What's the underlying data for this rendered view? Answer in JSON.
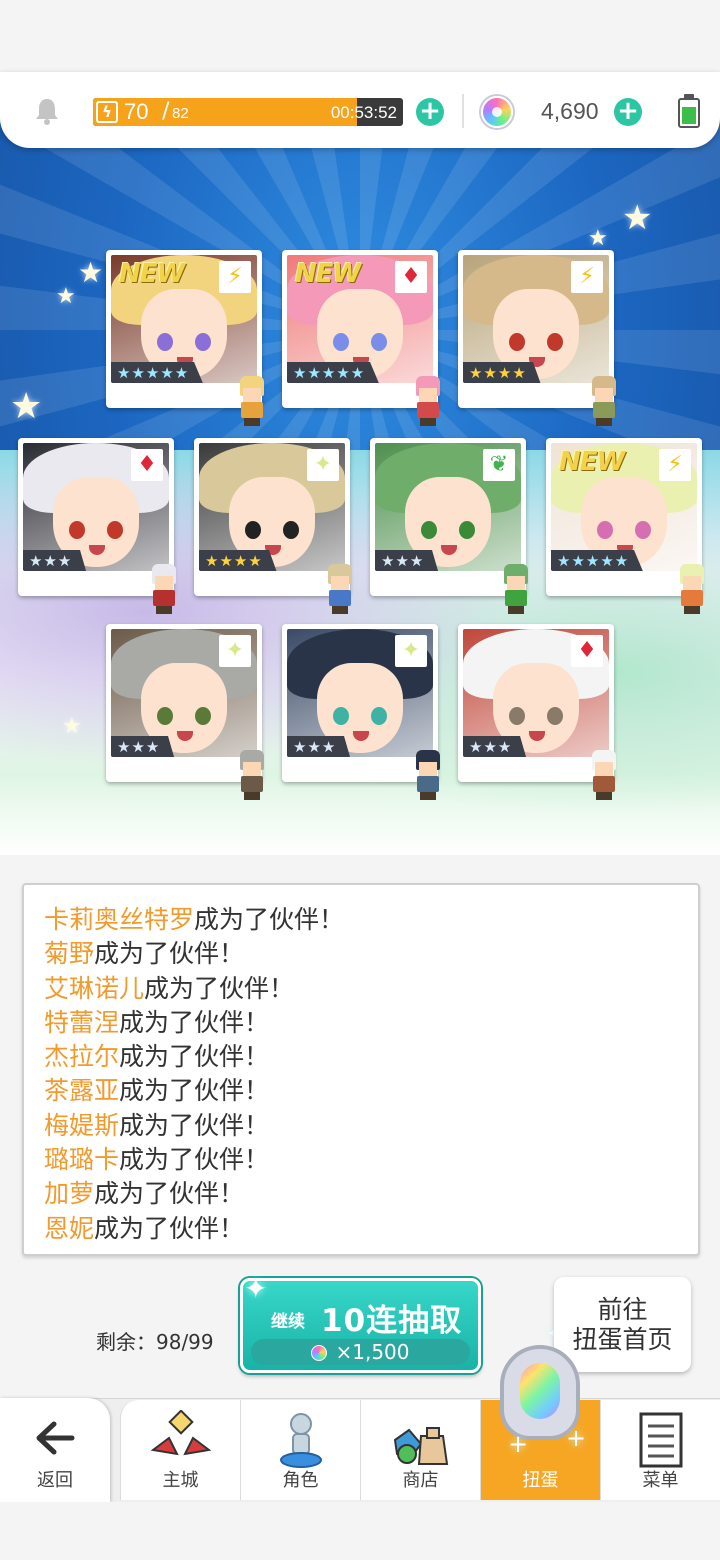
{
  "status": {
    "stamina_current": "70",
    "stamina_max": "82",
    "stamina_fraction": 0.85,
    "stamina_timer": "00:53:52",
    "gems": "4,690",
    "battery_icon": "battery-icon",
    "bell_icon": "bell-icon"
  },
  "colors": {
    "accent_orange": "#f7a21b",
    "accent_teal": "#2cc6a5",
    "name_orange": "#f39a2d",
    "nav_active": "#f6a623"
  },
  "cards": [
    {
      "new": "NEW",
      "element": "⚡",
      "element_color": "#f3c21a",
      "rarity": "★★★★★",
      "rarity_style": "rain",
      "hair": "#f3d47e",
      "eye": "#8b6fd6",
      "bg": "#7a3a2a",
      "sprite": "#e6a23c"
    },
    {
      "new": "NEW",
      "element": "♦",
      "element_color": "#e2263a",
      "rarity": "★★★★★",
      "rarity_style": "rain",
      "hair": "#f49ab8",
      "eye": "#7a8de8",
      "bg": "#f07a7a",
      "sprite": "#d24a4a"
    },
    {
      "new": "",
      "element": "⚡",
      "element_color": "#f3c21a",
      "rarity": "★★★★",
      "rarity_style": "gold",
      "hair": "#d6b98a",
      "eye": "#c0392b",
      "bg": "#b8a47a",
      "sprite": "#8a9a58"
    },
    {
      "new": "",
      "element": "♦",
      "element_color": "#e2263a",
      "rarity": "★★★",
      "rarity_style": "silver",
      "hair": "#e9e9ef",
      "eye": "#c0392b",
      "bg": "#2b2b33",
      "sprite": "#b73030"
    },
    {
      "new": "",
      "element": "✦",
      "element_color": "#d9e88a",
      "rarity": "★★★★",
      "rarity_style": "gold",
      "hair": "#d8c89a",
      "eye": "#222222",
      "bg": "#3a3a3a",
      "sprite": "#4a78c8"
    },
    {
      "new": "",
      "element": "❦",
      "element_color": "#3fb34f",
      "rarity": "★★★",
      "rarity_style": "silver",
      "hair": "#6fae6a",
      "eye": "#3a8a3a",
      "bg": "#4e8f4e",
      "sprite": "#3fa33f"
    },
    {
      "new": "NEW",
      "element": "⚡",
      "element_color": "#f3c21a",
      "rarity": "★★★★★",
      "rarity_style": "rain",
      "hair": "#eaf0b0",
      "eye": "#d66fb0",
      "bg": "#f0e3d6",
      "sprite": "#e67a3c"
    },
    {
      "new": "",
      "element": "✦",
      "element_color": "#d9e88a",
      "rarity": "★★★",
      "rarity_style": "silver",
      "hair": "#a9a9a6",
      "eye": "#5a7a3a",
      "bg": "#6b5a48",
      "sprite": "#6b5a48"
    },
    {
      "new": "",
      "element": "✦",
      "element_color": "#d9e88a",
      "rarity": "★★★",
      "rarity_style": "silver",
      "hair": "#2a3448",
      "eye": "#3fb3a3",
      "bg": "#3a4a66",
      "sprite": "#4a6a8a"
    },
    {
      "new": "",
      "element": "♦",
      "element_color": "#e2263a",
      "rarity": "★★★",
      "rarity_style": "silver",
      "hair": "#f4f4f4",
      "eye": "#8a7a6a",
      "bg": "#c0473a",
      "sprite": "#a05a3a"
    }
  ],
  "log": [
    {
      "name": "卡莉奥丝特罗",
      "text": "成为了伙伴！"
    },
    {
      "name": "菊野",
      "text": "成为了伙伴！"
    },
    {
      "name": "艾琳诺儿",
      "text": "成为了伙伴！"
    },
    {
      "name": "特蕾涅",
      "text": "成为了伙伴！"
    },
    {
      "name": "杰拉尔",
      "text": "成为了伙伴！"
    },
    {
      "name": "茶露亚",
      "text": "成为了伙伴！"
    },
    {
      "name": "梅媞斯",
      "text": "成为了伙伴！"
    },
    {
      "name": "璐璐卡",
      "text": "成为了伙伴！"
    },
    {
      "name": "加萝",
      "text": "成为了伙伴！"
    },
    {
      "name": "恩妮",
      "text": "成为了伙伴！"
    }
  ],
  "draw": {
    "remaining_label": "剩余：98/99",
    "continue_label": "继续",
    "main_label": "10连抽取",
    "cost": "×1,500"
  },
  "home_button": {
    "line1": "前往",
    "line2": "扭蛋首页"
  },
  "nav": {
    "back": "返回",
    "items": [
      {
        "label": "主城",
        "icon": "castle-icon"
      },
      {
        "label": "角色",
        "icon": "character-icon"
      },
      {
        "label": "商店",
        "icon": "shop-icon"
      },
      {
        "label": "扭蛋",
        "icon": "gacha-icon"
      },
      {
        "label": "菜单",
        "icon": "menu-icon"
      }
    ]
  }
}
